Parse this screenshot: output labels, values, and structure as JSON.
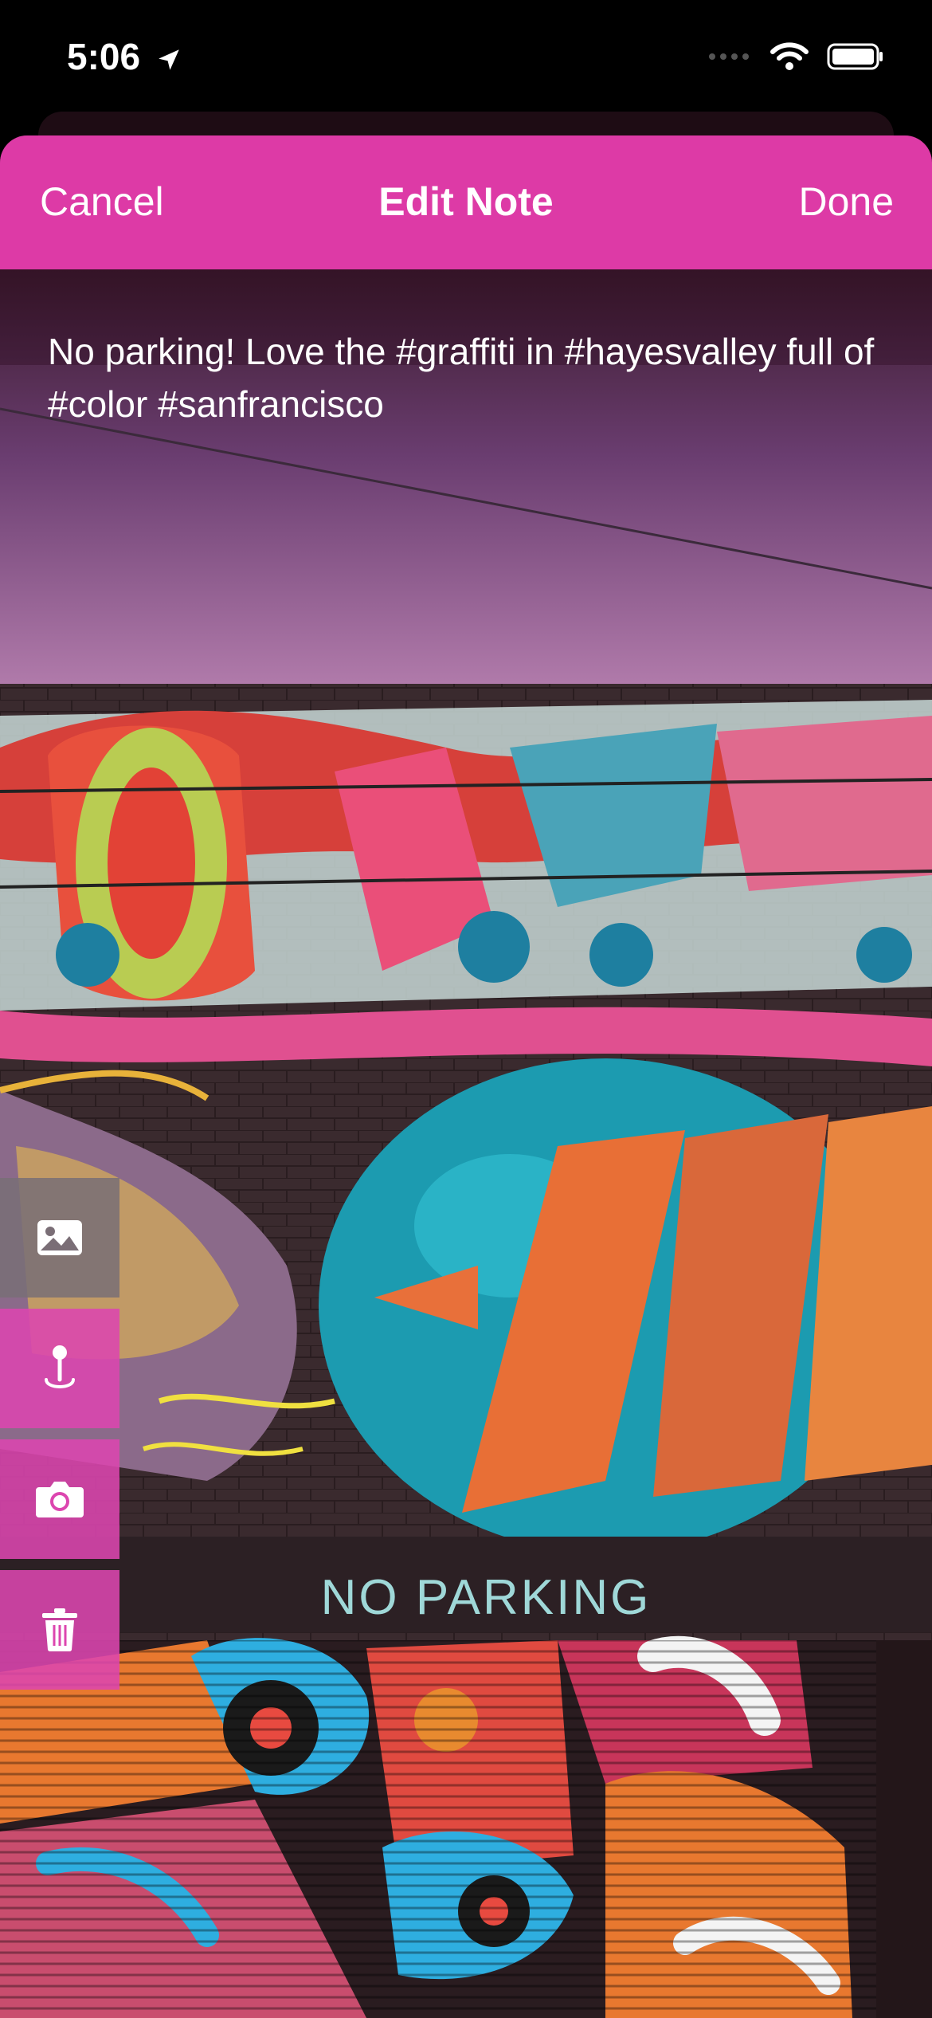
{
  "status_bar": {
    "time": "5:06"
  },
  "nav": {
    "cancel_label": "Cancel",
    "title": "Edit Note",
    "done_label": "Done"
  },
  "note": {
    "text": "No parking! Love the #graffiti in #hayesvalley full of #color #sanfrancisco"
  },
  "photo": {
    "sign_text": "NO PARKING"
  },
  "side_toolbar": {
    "buttons": [
      {
        "name": "image-icon",
        "active": false
      },
      {
        "name": "location-pin-icon",
        "active": true
      },
      {
        "name": "camera-icon",
        "active": true
      },
      {
        "name": "trash-icon",
        "active": true
      }
    ]
  },
  "colors": {
    "accent": "#DD3AA6",
    "inactive_button": "#7A6E76"
  }
}
